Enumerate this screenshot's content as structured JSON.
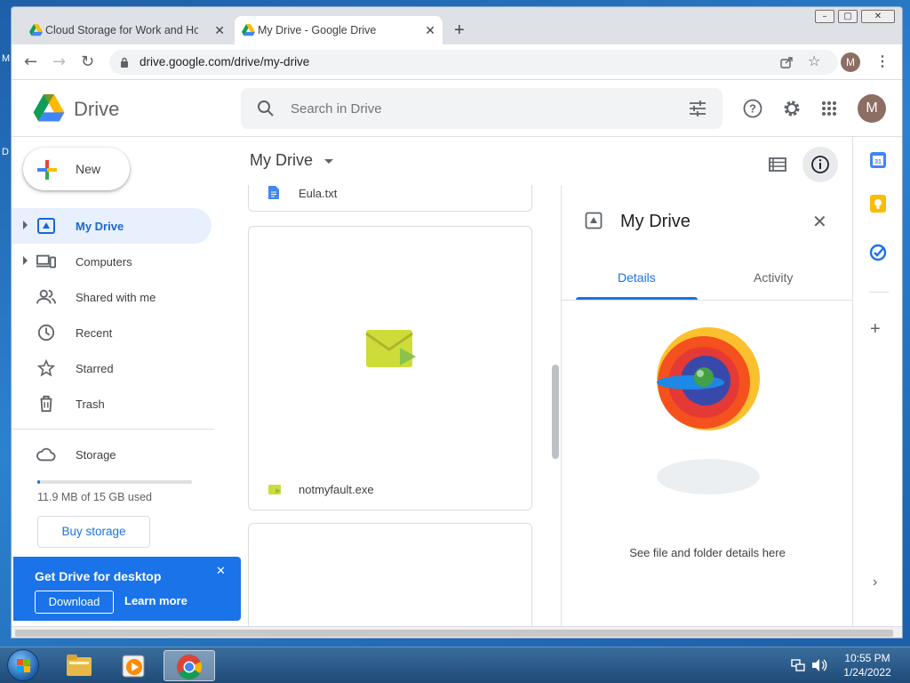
{
  "desktop": {
    "edge_letters": [
      "M",
      "D"
    ]
  },
  "browser": {
    "tabs": [
      {
        "title": "Cloud Storage for Work and Hom"
      },
      {
        "title": "My Drive - Google Drive"
      }
    ],
    "url": "drive.google.com/drive/my-drive",
    "profile_initial": "M"
  },
  "drive": {
    "product": "Drive",
    "search_placeholder": "Search in Drive",
    "avatar_initial": "M",
    "new_label": "New",
    "nav": [
      {
        "label": "My Drive",
        "icon": "my-drive-icon",
        "active": true,
        "expandable": true
      },
      {
        "label": "Computers",
        "icon": "computers-icon",
        "active": false,
        "expandable": true
      },
      {
        "label": "Shared with me",
        "icon": "shared-icon",
        "active": false,
        "expandable": false
      },
      {
        "label": "Recent",
        "icon": "clock-icon",
        "active": false,
        "expandable": false
      },
      {
        "label": "Starred",
        "icon": "star-icon",
        "active": false,
        "expandable": false
      },
      {
        "label": "Trash",
        "icon": "trash-icon",
        "active": false,
        "expandable": false
      }
    ],
    "storage": {
      "label": "Storage",
      "used_text": "11.9 MB of 15 GB used",
      "used_fraction": 0.0008,
      "buy_label": "Buy storage"
    },
    "promo": {
      "title": "Get Drive for desktop",
      "download_label": "Download",
      "learn_more_label": "Learn more"
    },
    "breadcrumb": "My Drive",
    "files": [
      {
        "name": "Eula.txt",
        "icon": "doc-icon"
      },
      {
        "name": "notmyfault.exe",
        "icon": "exe-icon"
      }
    ],
    "details": {
      "title": "My Drive",
      "tabs": [
        "Details",
        "Activity"
      ],
      "active_tab": "Details",
      "empty_text": "See file and folder details here"
    }
  },
  "taskbar": {
    "time": "10:55 PM",
    "date": "1/24/2022"
  },
  "colors": {
    "accent": "#1a73e8",
    "active_nav_bg": "#e8f0fe",
    "active_nav_text": "#1967d2"
  }
}
